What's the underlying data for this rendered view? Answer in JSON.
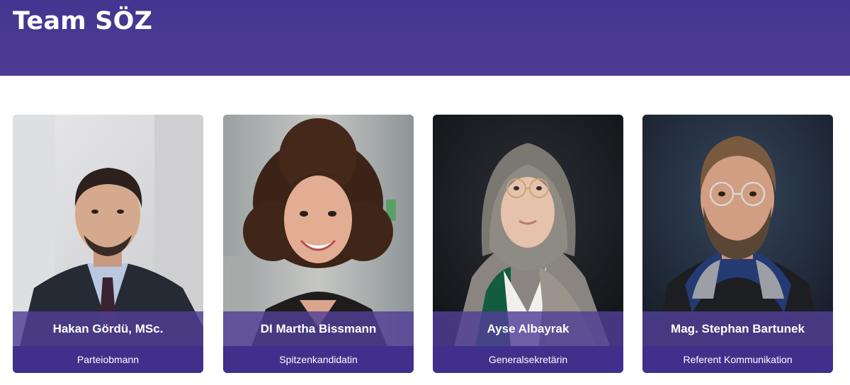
{
  "page": {
    "title": "Team SÖZ"
  },
  "team": [
    {
      "name": "Hakan Gördü, MSc.",
      "role": "Parteiobmann",
      "photo_icon": "portrait-man-suit"
    },
    {
      "name": "DI Martha Bissmann",
      "role": "Spitzenkandidatin",
      "photo_icon": "portrait-woman-curly-hair"
    },
    {
      "name": "Ayse Albayrak",
      "role": "Generalsekretärin",
      "photo_icon": "portrait-woman-headscarf"
    },
    {
      "name": "Mag. Stephan Bartunek",
      "role": "Referent Kommunikation",
      "photo_icon": "portrait-man-glasses"
    }
  ],
  "colors": {
    "header": "#4a3a93",
    "name_band": "#50409680",
    "role_band": "#40308c",
    "text": "#ffffff"
  }
}
